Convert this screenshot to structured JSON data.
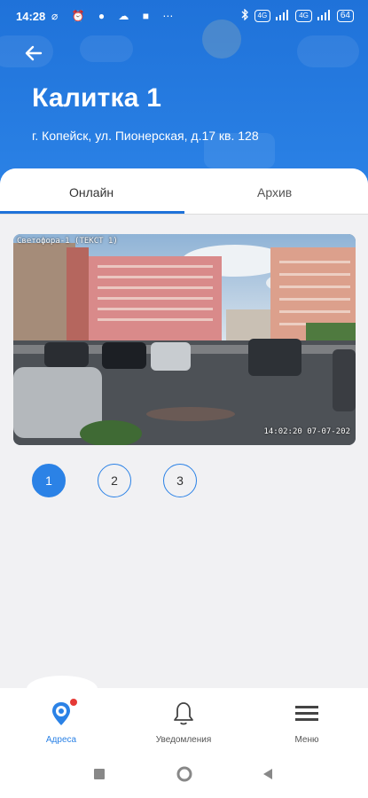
{
  "status_bar": {
    "time": "14:28",
    "left_icons": "⌀ ⏰ ● ☁ ■ ⋯",
    "battery": "64",
    "network_badge_1": "4G",
    "network_badge_2": "4G"
  },
  "header": {
    "back_icon": "arrow-left-icon",
    "title": "Калитка 1",
    "address": "г. Копейск, ул. Пионерская, д.17 кв. 128"
  },
  "tabs": [
    {
      "label": "Онлайн",
      "active": true
    },
    {
      "label": "Архив",
      "active": false
    }
  ],
  "video": {
    "overlay_label": "Светофора-1 (ТЕКСТ 1)",
    "timestamp": "14:02:20 07-07-202"
  },
  "camera_pages": [
    {
      "label": "1",
      "active": true
    },
    {
      "label": "2",
      "active": false
    },
    {
      "label": "3",
      "active": false
    }
  ],
  "bottom_nav": [
    {
      "label": "Адреса",
      "icon": "camera-pin-icon",
      "active": true,
      "has_badge": true
    },
    {
      "label": "Уведомления",
      "icon": "bell-icon",
      "active": false
    },
    {
      "label": "Меню",
      "icon": "menu-icon",
      "active": false
    }
  ],
  "colors": {
    "primary": "#2b82e6",
    "header_top": "#1f72d9",
    "badge": "#e53935"
  }
}
